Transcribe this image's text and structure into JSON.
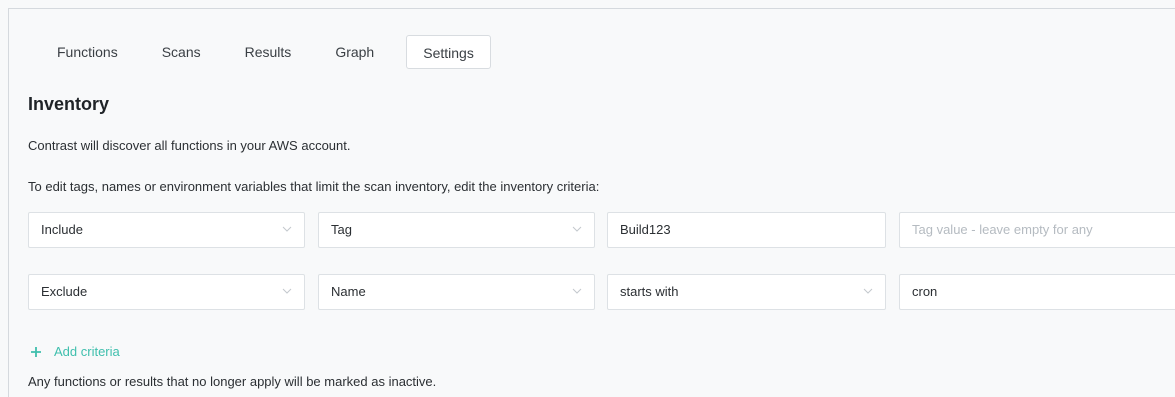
{
  "tabs": [
    {
      "label": "Functions",
      "active": false
    },
    {
      "label": "Scans",
      "active": false
    },
    {
      "label": "Results",
      "active": false
    },
    {
      "label": "Graph",
      "active": false
    },
    {
      "label": "Settings",
      "active": true
    }
  ],
  "inventory": {
    "title": "Inventory",
    "description": "Contrast will discover all functions in your AWS account.",
    "instructions": "To edit tags, names or environment variables that limit the scan inventory, edit the inventory criteria:",
    "criteria": [
      {
        "mode": "Include",
        "type": "Tag",
        "value": "Build123",
        "extra_value": "",
        "extra_placeholder": "Tag value - leave empty for any"
      },
      {
        "mode": "Exclude",
        "type": "Name",
        "operator": "starts with",
        "value": "cron"
      }
    ],
    "add_criteria_label": "Add criteria",
    "footer_note": "Any functions or results that no longer apply will be marked as inactive."
  },
  "colors": {
    "accent": "#3fbfad",
    "background": "#f8f9fa",
    "border": "#dde1e5"
  },
  "icons": {
    "dropdown": "chevron-down-icon",
    "add": "plus-icon"
  }
}
